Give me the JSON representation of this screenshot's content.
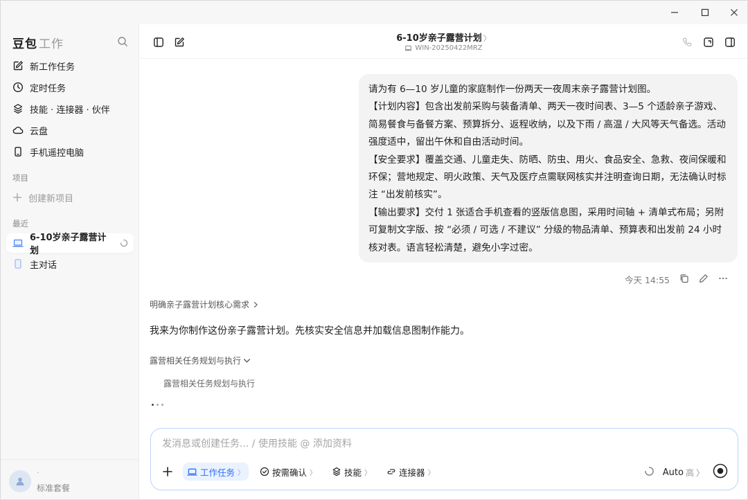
{
  "window": {
    "minimize": "—",
    "maximize": "☐",
    "close": "✕"
  },
  "sidebar": {
    "brand_main": "豆包",
    "brand_sub": "工作",
    "nav": [
      {
        "label": "新工作任务",
        "icon": "edit-icon"
      },
      {
        "label": "定时任务",
        "icon": "clock-icon"
      },
      {
        "label": "技能 · 连接器 · 伙伴",
        "icon": "layers-icon"
      },
      {
        "label": "云盘",
        "icon": "cloud-icon"
      },
      {
        "label": "手机遥控电脑",
        "icon": "phone-icon"
      }
    ],
    "projects_label": "项目",
    "create_project": "创建新项目",
    "recent_label": "最近",
    "recent": [
      {
        "label": "6-10岁亲子露营计划",
        "icon": "laptop-icon"
      },
      {
        "label": "主对话",
        "icon": "phone-icon"
      }
    ],
    "footer_name": "·",
    "footer_plan": "标准套餐"
  },
  "header": {
    "title": "6-10岁亲子露营计划",
    "chevron": "〉",
    "device": "WIN-20250422MRZ"
  },
  "user_message": {
    "paragraphs": [
      "请为有 6—10 岁儿童的家庭制作一份两天一夜周末亲子露营计划图。",
      "【计划内容】包含出发前采购与装备清单、两天一夜时间表、3—5 个适龄亲子游戏、简易餐食与备餐方案、预算拆分、返程收纳，以及下雨 / 高温 / 大风等天气备选。活动强度适中，留出午休和自由活动时间。",
      "【安全要求】覆盖交通、儿童走失、防晒、防虫、用火、食品安全、急救、夜间保暖和环保；营地规定、明火政策、天气及医疗点需联网核实并注明查询日期，无法确认时标注 “出发前核实”。",
      "【输出要求】交付 1 张适合手机查看的竖版信息图，采用时间轴 + 清单式布局；另附可复制文字版、按 “必须 / 可选 / 不建议” 分级的物品清单、预算表和出发前 24 小时核对表。语言轻松清楚，避免小字过密。"
    ],
    "time": "今天 14:55"
  },
  "assistant": {
    "step_link": "明确亲子露营计划核心需求",
    "reply": "我来为你制作这份亲子露营计划。先核实安全信息并加载信息图制作能力。",
    "task_toggle": "露营相关任务规划与执行",
    "task_sub": "露营相关任务规划与执行"
  },
  "composer": {
    "placeholder": "发消息或创建任务... / 使用技能 @ 添加资料",
    "add": "+",
    "tools": [
      {
        "label": "工作任务",
        "icon": "laptop-icon",
        "active": true
      },
      {
        "label": "按需确认",
        "icon": "check-circle-icon",
        "active": false
      },
      {
        "label": "技能",
        "icon": "layers-icon",
        "active": false
      },
      {
        "label": "连接器",
        "icon": "link-icon",
        "active": false
      }
    ],
    "model": "Auto",
    "level": "高",
    "chevron": "〉"
  },
  "colors": {
    "accent": "#2b6ff2",
    "accent_bg": "#eaf2ff",
    "sidebar_bg": "#f7f7f7",
    "bubble_bg": "#f3f3f3",
    "composer_border": "#b9d4fb"
  }
}
